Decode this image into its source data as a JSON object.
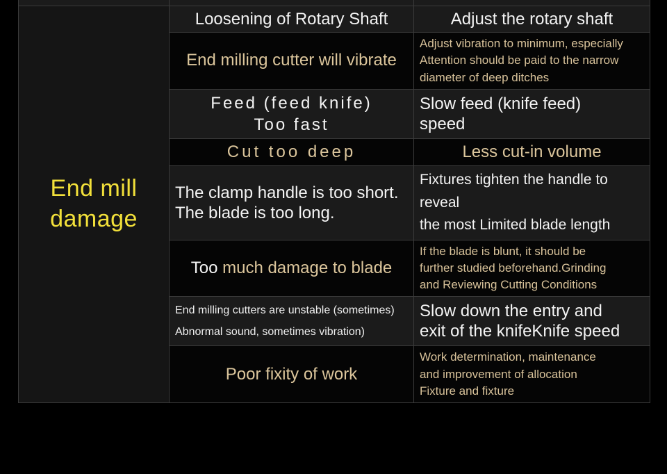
{
  "table": {
    "category": "End mill damage",
    "rows": [
      {
        "cause": "Loosening of Rotary Shaft",
        "fix": "Adjust the rotary shaft",
        "cause_style": "w-big",
        "fix_style": "w-big",
        "cause_align": "ctr",
        "fix_align": "ctr",
        "shade": "shade"
      },
      {
        "cause": "End milling cutter will vibrate",
        "fix_lines": [
          "Adjust vibration to minimum, especially",
          "Attention should be paid to the narrow",
          "diameter of deep ditches"
        ],
        "cause_style": "g-big",
        "fix_style": "g-mid",
        "cause_align": "ctr",
        "fix_align": "lft",
        "shade": "dark"
      },
      {
        "cause_lines": [
          "Feed (feed knife)",
          "Too fast"
        ],
        "fix_lines": [
          "Slow feed (knife feed)",
          "speed"
        ],
        "cause_style": "w-sp",
        "fix_style": "w-big",
        "cause_align": "ctr",
        "fix_align": "lft",
        "shade": "shade"
      },
      {
        "cause": "Cut too deep",
        "fix": "Less cut-in volume",
        "cause_style": "g-sp",
        "fix_style": "g-big",
        "cause_align": "ctr",
        "fix_align": "ctr",
        "shade": "dark"
      },
      {
        "cause_lines": [
          "The clamp handle is too short.",
          "The blade is too long."
        ],
        "fix_lines": [
          "Fixtures tighten the handle to reveal",
          "the most Limited blade length"
        ],
        "cause_style": "w-big",
        "fix_style": "w-mid",
        "cause_align": "lft",
        "fix_align": "lft",
        "shade": "shade"
      },
      {
        "cause": "Too much damage to blade",
        "cause_lead": "Too",
        "cause_rest": " much damage to blade",
        "fix_lines": [
          "If the blade is blunt, it should be",
          "further studied beforehand.Grinding",
          "and Reviewing Cutting Conditions"
        ],
        "cause_style": "g-big",
        "fix_style": "g-mid",
        "cause_align": "ctr",
        "fix_align": "lft",
        "shade": "dark"
      },
      {
        "cause_lines": [
          "End milling cutters are unstable (sometimes)",
          "Abnormal sound, sometimes vibration)"
        ],
        "fix_lines": [
          "Slow down the entry and",
          "exit of the knifeKnife speed"
        ],
        "cause_style": "w-sm",
        "fix_style": "w-big",
        "cause_align": "lft",
        "fix_align": "lft",
        "shade": "shade"
      },
      {
        "cause": "Poor fixity of work",
        "fix_lines": [
          "Work determination, maintenance",
          "and improvement of allocation",
          "Fixture and fixture"
        ],
        "cause_style": "g-big",
        "fix_style": "g-mid",
        "cause_align": "ctr",
        "fix_align": "lft",
        "shade": "dark"
      }
    ]
  },
  "colors": {
    "background": "#000000",
    "row_shade": "#1b1b1b",
    "row_dark": "#050505",
    "border": "#3a3a3a",
    "category_text": "#f2e03a",
    "white_text": "#f3f3f3",
    "gold_text": "#dcc69c"
  }
}
